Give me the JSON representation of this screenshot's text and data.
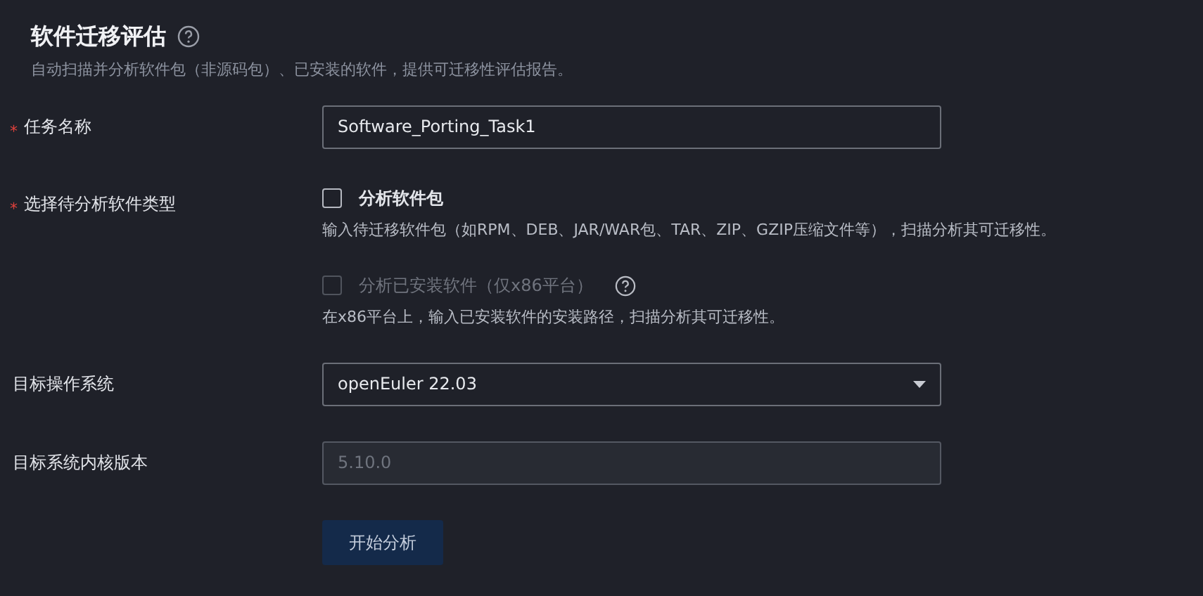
{
  "header": {
    "title": "软件迁移评估",
    "description": "自动扫描并分析软件包（非源码包）、已安装的软件，提供可迁移性评估报告。"
  },
  "fields": [
    {
      "kind": "text",
      "label": "任务名称",
      "required_mark": "*",
      "value": "Software_Porting_Task1",
      "disabled": false
    },
    {
      "kind": "checks",
      "label": "选择待分析软件类型",
      "required_mark": "*",
      "options": [
        {
          "label": "分析软件包",
          "checked": false,
          "disabled": false,
          "help": false,
          "hint": "输入待迁移软件包（如RPM、DEB、JAR/WAR包、TAR、ZIP、GZIP压缩文件等），扫描分析其可迁移性。"
        },
        {
          "label": "分析已安装软件（仅x86平台）",
          "checked": false,
          "disabled": true,
          "help": true,
          "hint": "在x86平台上，输入已安装软件的安装路径，扫描分析其可迁移性。"
        }
      ]
    },
    {
      "kind": "select",
      "label": "目标操作系统",
      "value": "openEuler 22.03",
      "disabled": false
    },
    {
      "kind": "text",
      "label": "目标系统内核版本",
      "placeholder": "5.10.0",
      "disabled": true
    }
  ],
  "submit": {
    "label": "开始分析"
  }
}
